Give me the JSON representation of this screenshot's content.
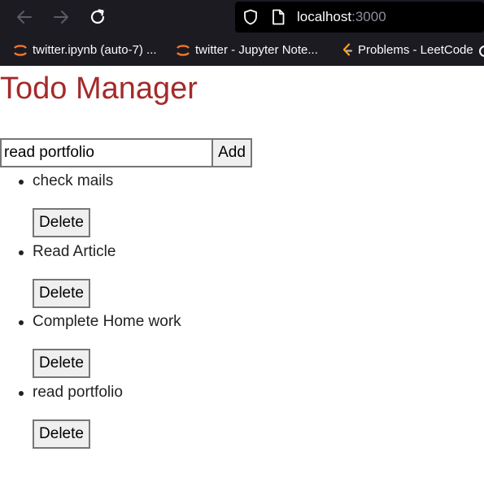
{
  "browser": {
    "url_host": "localhost",
    "url_port": ":3000",
    "bookmarks": [
      {
        "label": "twitter.ipynb (auto-7) ...",
        "icon": "jupyter-icon"
      },
      {
        "label": "twitter - Jupyter Note...",
        "icon": "jupyter-icon"
      },
      {
        "label": "Problems - LeetCode",
        "icon": "leetcode-icon"
      }
    ]
  },
  "app": {
    "title": "Todo Manager",
    "title_color": "#a52a2a",
    "input_value": "read portfolio",
    "add_label": "Add",
    "delete_label": "Delete",
    "todos": [
      {
        "text": "check mails"
      },
      {
        "text": "Read Article"
      },
      {
        "text": "Complete Home work"
      },
      {
        "text": "read portfolio"
      }
    ]
  }
}
